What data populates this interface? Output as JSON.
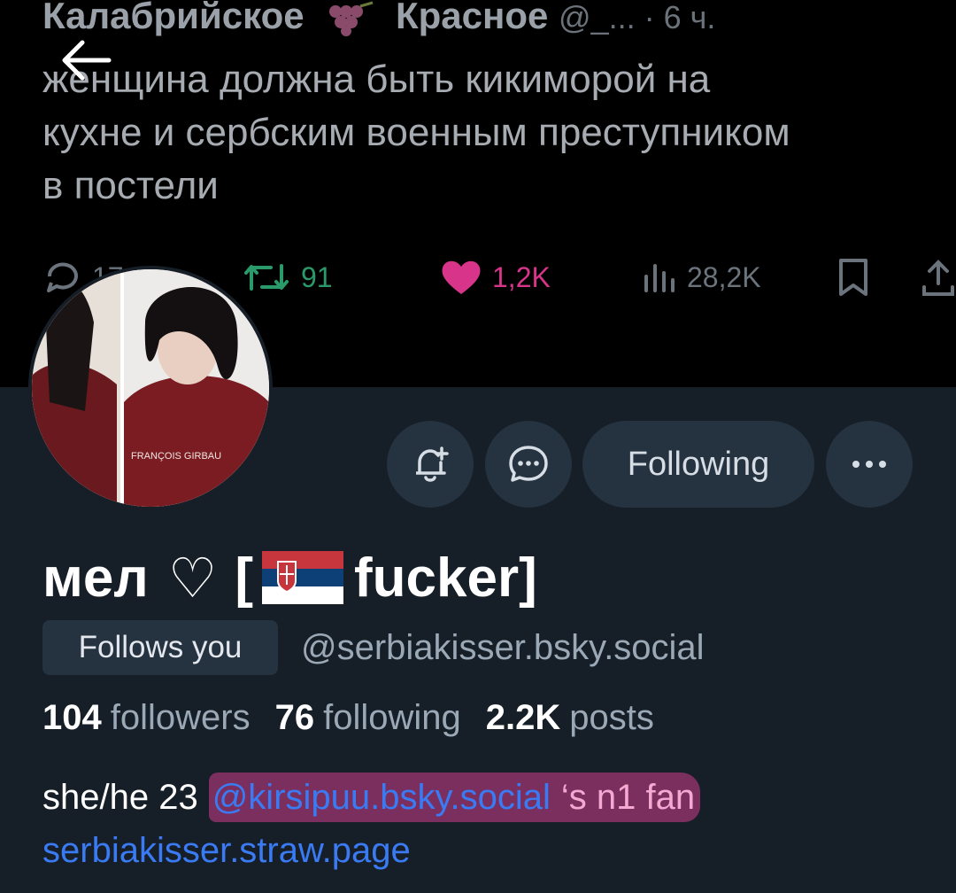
{
  "banner": {
    "author_name": "Калабрийское",
    "author_name_2": "Красное",
    "author_meta": "@_... · 6 ч.",
    "tweet_text": "женщина должна быть кикиморой на\nкухне и сербским военным преступником\nв постели",
    "replies": "17",
    "retweets": "91",
    "likes": "1,2K",
    "views": "28,2K"
  },
  "header": {
    "back_icon": "arrow-left-icon"
  },
  "actions": {
    "subscribe_icon": "bell-plus-icon",
    "message_icon": "chat-bubble-icon",
    "following_label": "Following",
    "more_icon": "ellipsis-icon"
  },
  "profile": {
    "display_name_prefix": "мел",
    "display_name_heart": "♡",
    "display_name_bracket_open": "[",
    "display_name_word": "fucker]",
    "follows_you_label": "Follows you",
    "handle": "@serbiakisser.bsky.social",
    "stats": {
      "followers_count": "104",
      "followers_label": "followers",
      "following_count": "76",
      "following_label": "following",
      "posts_count": "2.2K",
      "posts_label": "posts"
    },
    "bio": {
      "text": "she/he 23",
      "mention": "@kirsipuu.bsky.social",
      "suffix": "‘s n1 fan",
      "link": "serbiakisser.straw.page"
    }
  },
  "colors": {
    "background": "#161e27",
    "button_bg": "#253240",
    "link_blue": "#3a7bf4",
    "highlight_pink": "#7a2f5e",
    "retweet_green": "#2a9a6a",
    "like_pink": "#d7348a"
  }
}
